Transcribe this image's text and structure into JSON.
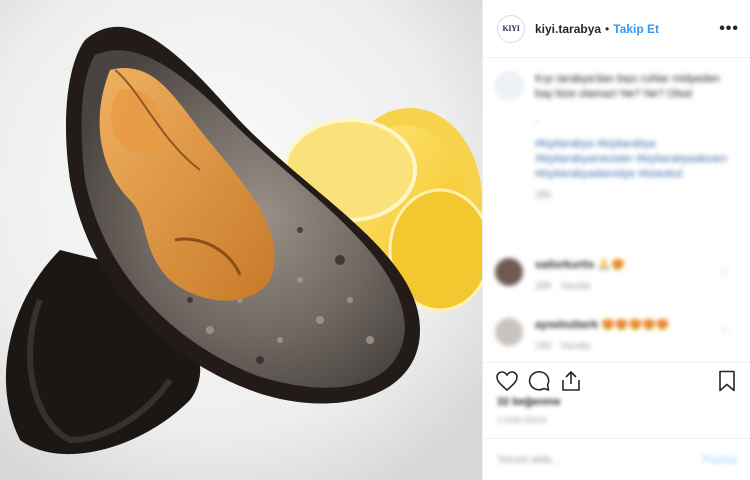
{
  "post": {
    "username": "kiyi.tarabya",
    "separator": "•",
    "follow_label": "Takip Et",
    "more_label": "•••",
    "logo_text": "KIYI"
  },
  "comments": {
    "caption": "Kıyı tarabya'dan bazı ruhlar midyeden bay bize olamaz! Ne? Ne? Olsa!",
    "caption_dots": ".",
    "hashtags": "#kiyitarabya #kiyitarabya #kiyitarabyamezeler #kiyitarabyaaksam #kiyitarabyadamidye #istanbul",
    "caption_time": "28h",
    "comment1_user": "sailorkurtis",
    "comment1_emoji": "🙏😍",
    "comment1_time": "28h",
    "comment1_reply": "Yanıtla",
    "comment2_user": "ayselozberk",
    "comment2_emoji": "😍😍😍😍😍",
    "comment2_time": "19h",
    "comment2_reply": "Yanıtla"
  },
  "footer": {
    "likes": "32 beğenme",
    "time": "2 GÜN ÖNCE",
    "comment_placeholder": "Yorum ekle...",
    "post_label": "Paylaş"
  },
  "icons": [
    "heart-icon",
    "comment-icon",
    "share-icon",
    "bookmark-icon"
  ],
  "colors": {
    "accent": "#3897f0",
    "text": "#262626",
    "muted": "#999999",
    "border": "#efefef"
  }
}
